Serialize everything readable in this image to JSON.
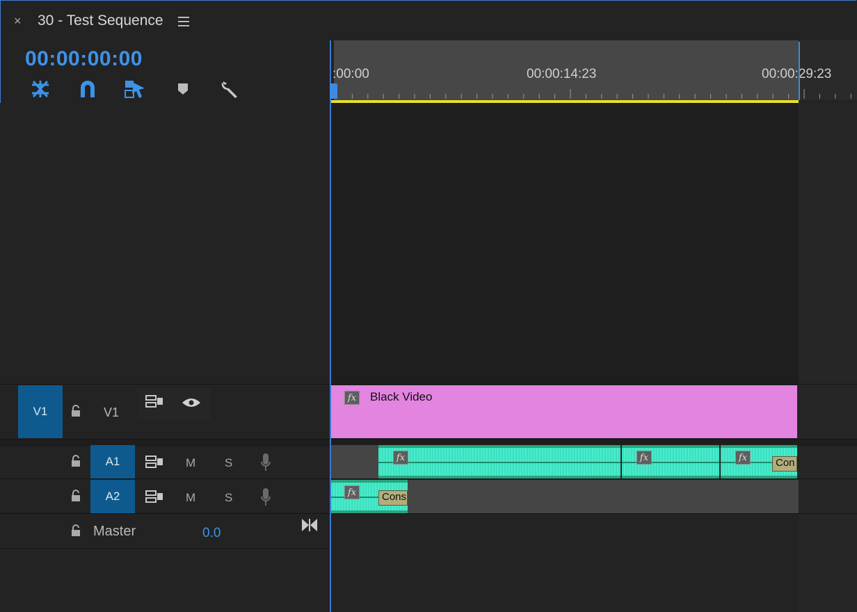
{
  "header": {
    "close": "×",
    "title": "30 - Test Sequence",
    "timecode": "00:00:00:00"
  },
  "ruler": {
    "labels": [
      ":00:00",
      "00:00:14:23",
      "00:00:29:23"
    ]
  },
  "tracks": {
    "v1": {
      "toggle": "V1",
      "name": "V1"
    },
    "a1": {
      "toggle": "A1",
      "m": "M",
      "s": "S"
    },
    "a2": {
      "toggle": "A2",
      "m": "M",
      "s": "S"
    },
    "master": {
      "name": "Master",
      "value": "0.0"
    }
  },
  "clips": {
    "video": {
      "name": "Black Video",
      "color": "#e384e1"
    },
    "fx": "fx",
    "a1_label": "Con",
    "a2_label": "Cons"
  },
  "colors": {
    "accent": "#3d93e8",
    "audio": "#2aa37e",
    "workarea": "#e9df2b"
  },
  "icons": [
    "close-icon",
    "menu-icon",
    "ripple-edit-icon",
    "snap-magnet-icon",
    "linked-selection-icon",
    "marker-icon",
    "wrench-icon",
    "lock-icon",
    "toggle-sync-icon",
    "eye-icon",
    "mic-icon",
    "bowtie-icon"
  ]
}
